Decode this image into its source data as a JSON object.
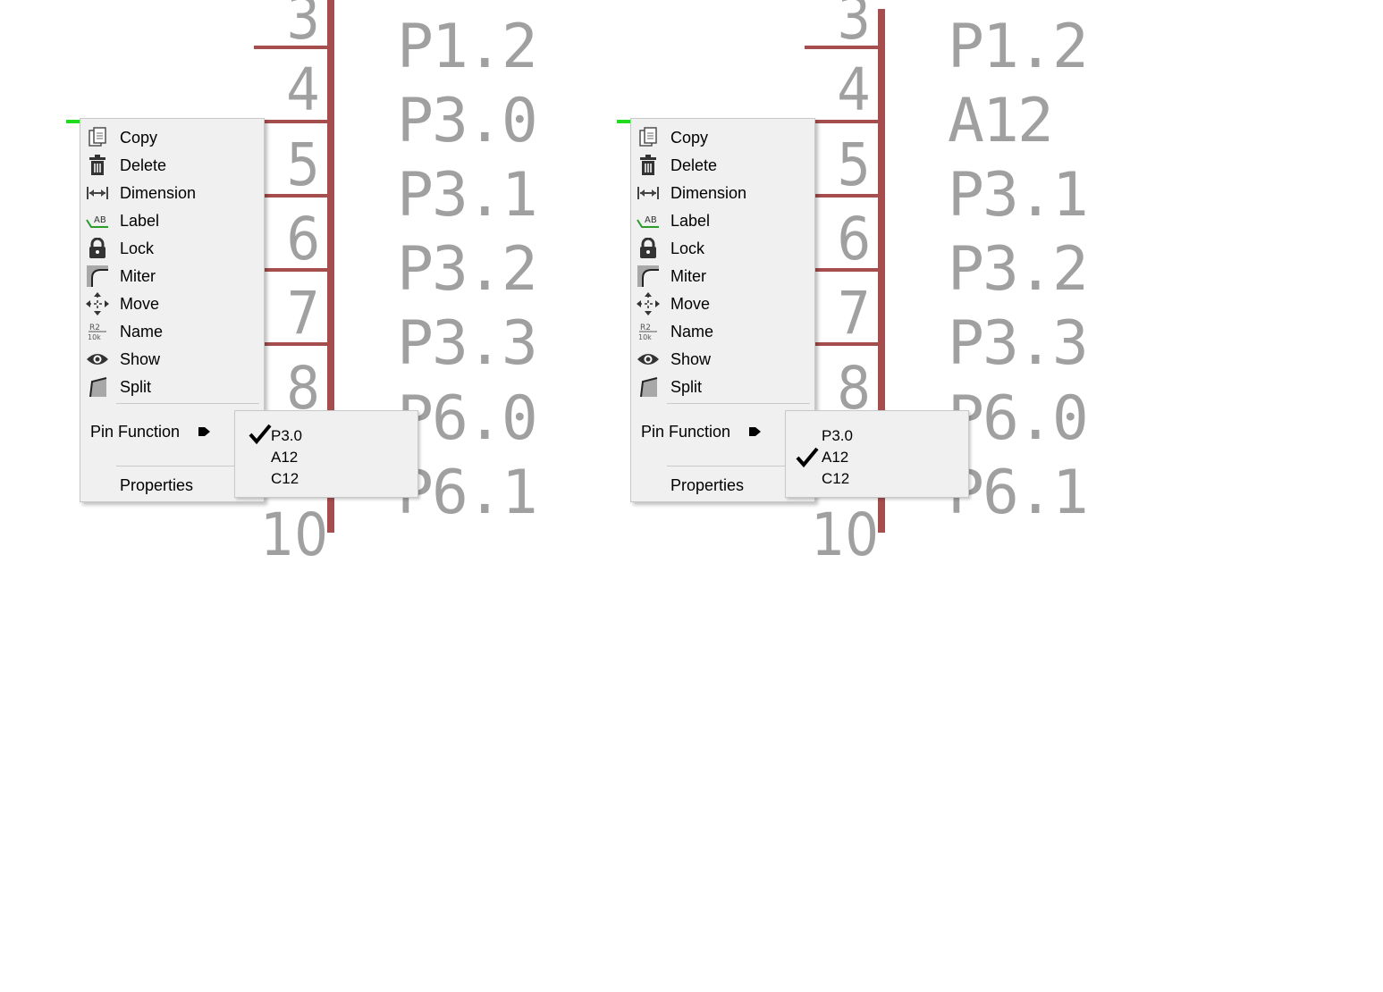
{
  "schematic": {
    "pin_numbers": [
      "3",
      "4",
      "5",
      "6",
      "7",
      "8",
      "10"
    ],
    "left_functions": [
      "P1.2",
      "P3.0",
      "P3.1",
      "P3.2",
      "P3.3",
      "P6.0",
      "P6.1"
    ],
    "right_functions": [
      "P1.2",
      "A12",
      "P3.1",
      "P3.2",
      "P3.3",
      "P6.0",
      "P6.1"
    ],
    "wire_color": "#a64d4d",
    "text_color": "#a0a0a0",
    "selection_color": "#1fdc1f"
  },
  "context_menu": {
    "items": [
      {
        "label": "Copy",
        "icon": "copy-icon"
      },
      {
        "label": "Delete",
        "icon": "trash-icon"
      },
      {
        "label": "Dimension",
        "icon": "dimension-icon"
      },
      {
        "label": "Label",
        "icon": "label-icon"
      },
      {
        "label": "Lock",
        "icon": "lock-icon"
      },
      {
        "label": "Miter",
        "icon": "miter-icon"
      },
      {
        "label": "Move",
        "icon": "move-icon"
      },
      {
        "label": "Name",
        "icon": "name-icon"
      },
      {
        "label": "Show",
        "icon": "eye-icon"
      },
      {
        "label": "Split",
        "icon": "split-icon"
      }
    ],
    "pin_function_label": "Pin Function",
    "properties_label": "Properties"
  },
  "submenu": {
    "options": [
      "P3.0",
      "A12",
      "C12"
    ],
    "left_checked": "P3.0",
    "right_checked": "A12"
  }
}
